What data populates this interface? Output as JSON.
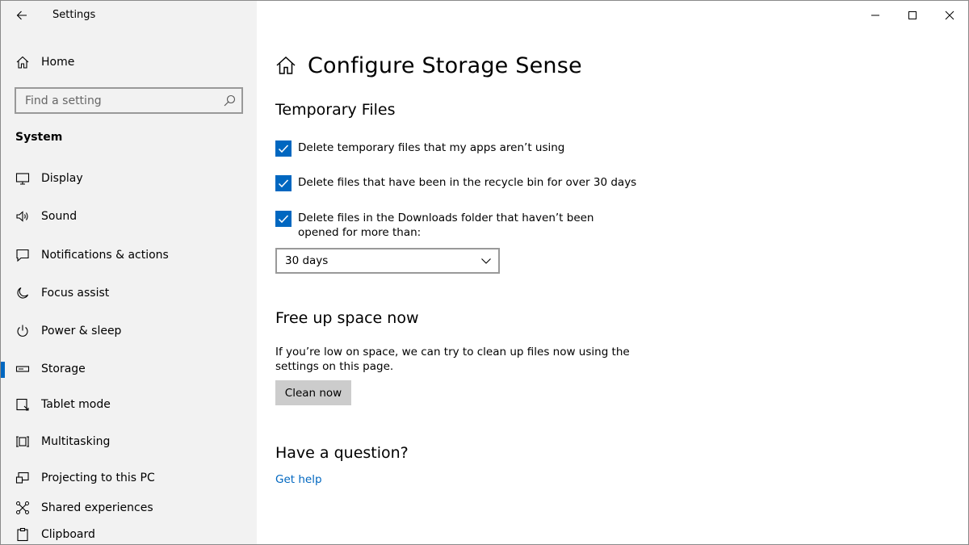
{
  "window": {
    "app_title": "Settings"
  },
  "sidebar": {
    "home_label": "Home",
    "search_placeholder": "Find a setting",
    "section_title": "System",
    "items": [
      {
        "label": "Display",
        "icon": "monitor-icon"
      },
      {
        "label": "Sound",
        "icon": "speaker-icon"
      },
      {
        "label": "Notifications & actions",
        "icon": "notification-icon"
      },
      {
        "label": "Focus assist",
        "icon": "moon-icon"
      },
      {
        "label": "Power & sleep",
        "icon": "power-icon"
      },
      {
        "label": "Storage",
        "icon": "storage-icon",
        "active": true
      },
      {
        "label": "Tablet mode",
        "icon": "tablet-icon"
      },
      {
        "label": "Multitasking",
        "icon": "multitasking-icon"
      },
      {
        "label": "Projecting to this PC",
        "icon": "projecting-icon"
      },
      {
        "label": "Shared experiences",
        "icon": "shared-icon"
      },
      {
        "label": "Clipboard",
        "icon": "clipboard-icon"
      }
    ]
  },
  "main": {
    "page_title": "Configure Storage Sense",
    "temp_files": {
      "heading": "Temporary Files",
      "options": [
        {
          "label": "Delete temporary files that my apps aren’t using",
          "checked": true
        },
        {
          "label": "Delete files that have been in the recycle bin for over 30 days",
          "checked": true
        },
        {
          "label": "Delete files in the Downloads folder that haven’t been opened for more than:",
          "checked": true
        }
      ],
      "downloads_dropdown_value": "30 days"
    },
    "free_space": {
      "heading": "Free up space now",
      "description": "If you’re low on space, we can try to clean up files now using the settings on this page.",
      "button_label": "Clean now"
    },
    "question": {
      "heading": "Have a question?",
      "link_label": "Get help"
    }
  },
  "colors": {
    "accent": "#0067c0",
    "sidebar_bg": "#f2f2f2",
    "button_bg": "#cccccc"
  }
}
